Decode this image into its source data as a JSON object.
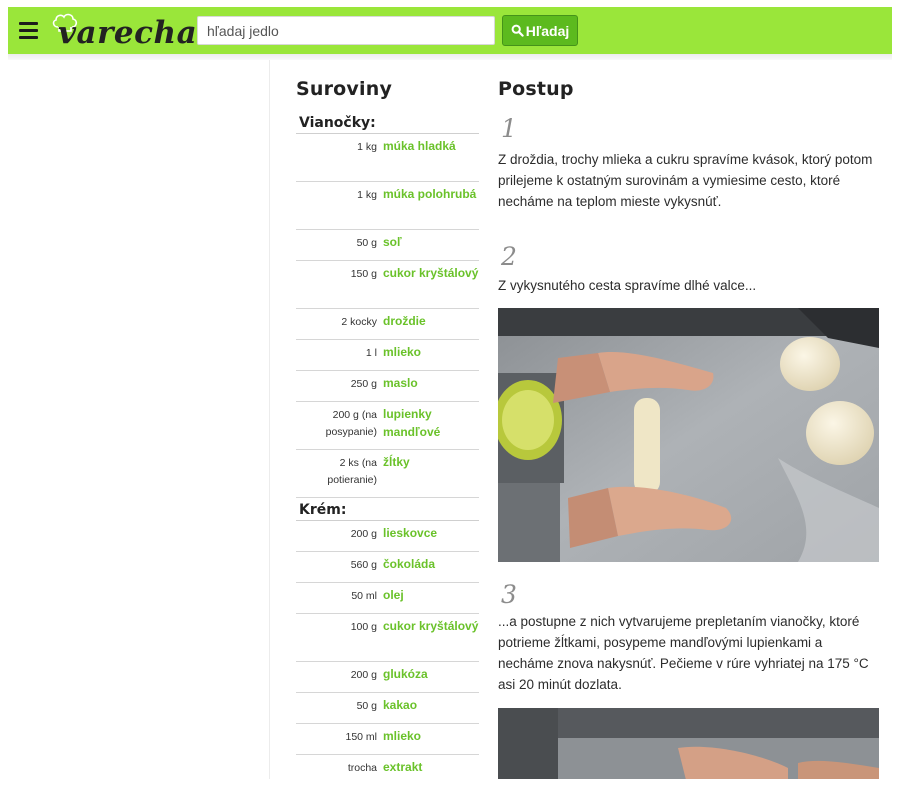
{
  "header": {
    "logo_text": "varecha",
    "search_placeholder": "hľadaj jedlo",
    "search_button_label": "Hľadaj",
    "brand_color": "#9ae63a",
    "button_color": "#5cba1e"
  },
  "ingredients": {
    "title": "Suroviny",
    "groups": [
      {
        "title": "Vianočky:",
        "items": [
          {
            "amount": "1 kg",
            "name": "múka hladká"
          },
          {
            "amount": "1 kg",
            "name": "múka polohrubá"
          },
          {
            "amount": "50 g",
            "name": "soľ"
          },
          {
            "amount": "150 g",
            "name": "cukor kryštálový"
          },
          {
            "amount": "2 kocky",
            "name": "droždie"
          },
          {
            "amount": "1 l",
            "name": "mlieko"
          },
          {
            "amount": "250 g",
            "name": "maslo"
          },
          {
            "amount": "200 g (na posypanie)",
            "name": "lupienky mandľové"
          },
          {
            "amount": "2 ks (na potieranie)",
            "name": "žĺtky"
          }
        ]
      },
      {
        "title": "Krém:",
        "items": [
          {
            "amount": "200 g",
            "name": "lieskovce"
          },
          {
            "amount": "560 g",
            "name": "čokoláda"
          },
          {
            "amount": "50 ml",
            "name": "olej"
          },
          {
            "amount": "100 g",
            "name": "cukor kryštálový"
          },
          {
            "amount": "200 g",
            "name": "glukóza"
          },
          {
            "amount": "50 g",
            "name": "kakao"
          },
          {
            "amount": "150 ml",
            "name": "mlieko"
          },
          {
            "amount": "trocha",
            "name": "extrakt vanilkový"
          }
        ]
      }
    ]
  },
  "steps": {
    "title": "Postup",
    "items": [
      {
        "number": "1",
        "text": "Z droždia, trochy mlieka a cukru spravíme kvások, ktorý potom prilejeme k ostatným surovinám a vymiesime cesto, ktoré necháme na teplom mieste vykysnúť."
      },
      {
        "number": "2",
        "text": "Z vykysnutého cesta spravíme dlhé valce..."
      },
      {
        "number": "3",
        "text": "...a postupne z nich vytvarujeme prepletaním vianočky, ktoré potrieme žĺtkami, posypeme mandľovými lupienkami a necháme znova nakysnúť. Pečieme v rúre vyhriatej na 175 °C asi 20 minút dozlata."
      }
    ]
  }
}
